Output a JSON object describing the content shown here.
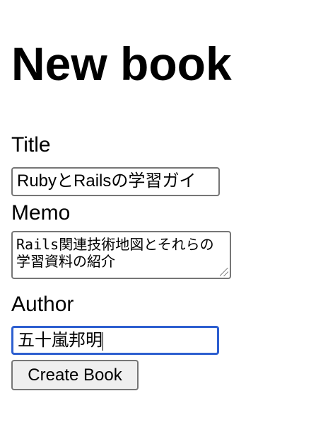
{
  "page": {
    "heading": "New book"
  },
  "form": {
    "title_label": "Title",
    "title_value": "RubyとRailsの学習ガイ",
    "memo_label": "Memo",
    "memo_value": "Rails関連技術地図とそれらの学習資料の紹介",
    "author_label": "Author",
    "author_value": "五十嵐邦明",
    "submit_label": "Create Book"
  },
  "colors": {
    "focus": "#2d5fd0"
  }
}
